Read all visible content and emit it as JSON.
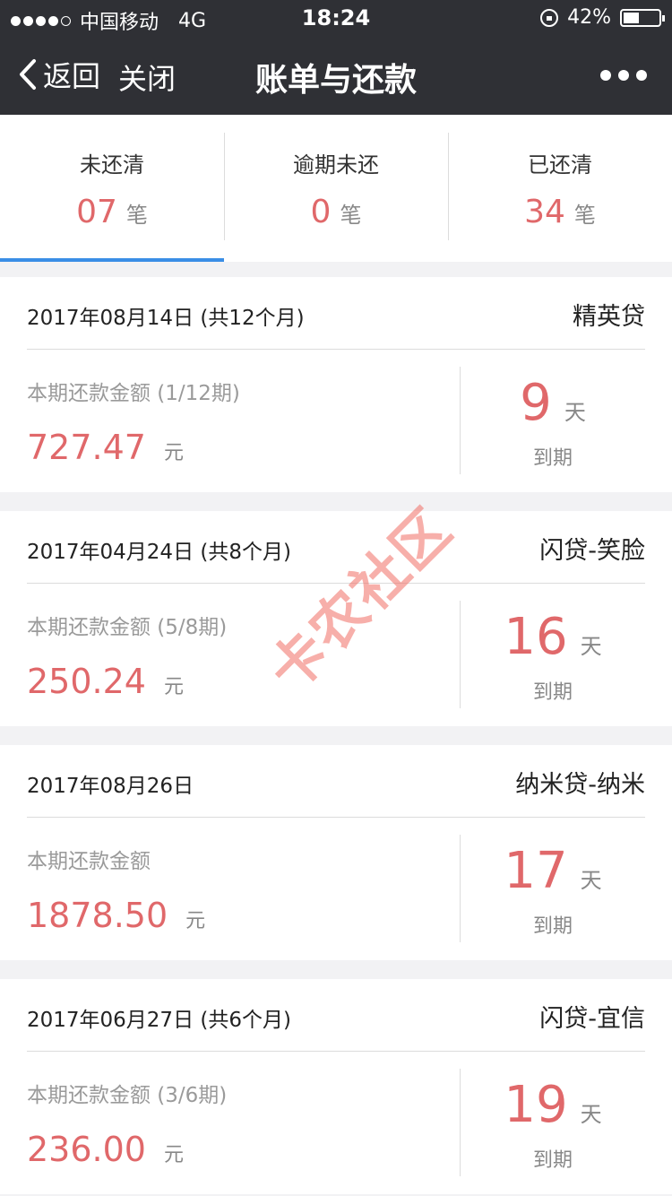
{
  "status_bar": {
    "carrier": "中国移动",
    "network": "4G",
    "time": "18:24",
    "battery": "42%",
    "signal_level": 4,
    "signal_max": 5
  },
  "nav": {
    "back_label": "返回",
    "close_label": "关闭",
    "title": "账单与还款"
  },
  "summary": {
    "tabs": [
      {
        "label": "未还清",
        "count": "07",
        "unit": "笔"
      },
      {
        "label": "逾期未还",
        "count": "0",
        "unit": "笔"
      },
      {
        "label": "已还清",
        "count": "34",
        "unit": "笔"
      }
    ],
    "active_tab": 0
  },
  "bills": [
    {
      "date": "2017年08月14日 (共12个月)",
      "product": "精英贷",
      "amount_label": "本期还款金额 (1/12期)",
      "amount": "727.47",
      "amount_unit": "元",
      "days": "9",
      "days_unit": "天",
      "due_label": "到期"
    },
    {
      "date": "2017年04月24日 (共8个月)",
      "product": "闪贷-笑脸",
      "amount_label": "本期还款金额 (5/8期)",
      "amount": "250.24",
      "amount_unit": "元",
      "days": "16",
      "days_unit": "天",
      "due_label": "到期"
    },
    {
      "date": "2017年08月26日",
      "product": "纳米贷-纳米",
      "amount_label": "本期还款金额",
      "amount": "1878.50",
      "amount_unit": "元",
      "days": "17",
      "days_unit": "天",
      "due_label": "到期"
    },
    {
      "date": "2017年06月27日 (共6个月)",
      "product": "闪贷-宜信",
      "amount_label": "本期还款金额 (3/6期)",
      "amount": "236.00",
      "amount_unit": "元",
      "days": "19",
      "days_unit": "天",
      "due_label": "到期"
    }
  ],
  "watermark": "卡农社区",
  "colors": {
    "accent_red": "#e0686a",
    "tab_blue": "#3a8ee6",
    "nav_bg": "#2f3035"
  }
}
